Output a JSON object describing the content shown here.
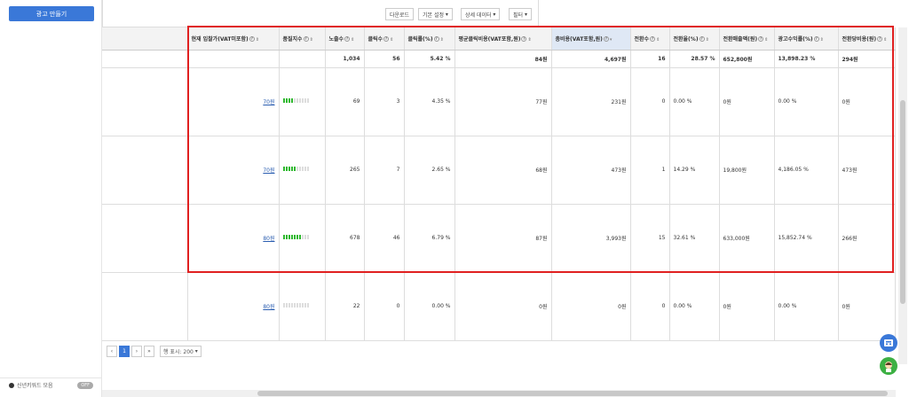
{
  "sidebar": {
    "create_ad_label": "광고 만들기",
    "footer_label": "신년키워드 모음",
    "footer_badge": "OFF"
  },
  "toolbar": {
    "download": "다운로드",
    "basic_settings": "기본 설정",
    "detail_data": "상세 데이터",
    "filter": "필터"
  },
  "table": {
    "headers": [
      "현재 입찰가(VAT미포함)",
      "품질지수",
      "노출수",
      "클릭수",
      "클릭률(%)",
      "평균클릭비용(VAT포함,원)",
      "총비용(VAT포함,원)",
      "전환수",
      "전환율(%)",
      "전환매출액(원)",
      "광고수익률(%)",
      "전환당비용(원)"
    ],
    "totals": [
      "",
      "",
      "1,034",
      "56",
      "5.42 %",
      "84원",
      "4,697원",
      "16",
      "28.57 %",
      "652,800원",
      "13,898.23 %",
      "294원"
    ],
    "rows": [
      {
        "bid": "70원",
        "quality": 4,
        "cells": [
          "69",
          "3",
          "4.35 %",
          "77원",
          "231원",
          "0",
          "0.00 %",
          "0원",
          "0.00 %",
          "0원"
        ]
      },
      {
        "bid": "70원",
        "quality": 5,
        "cells": [
          "265",
          "7",
          "2.65 %",
          "68원",
          "473원",
          "1",
          "14.29 %",
          "19,800원",
          "4,186.05 %",
          "473원"
        ]
      },
      {
        "bid": "80원",
        "quality": 7,
        "cells": [
          "678",
          "46",
          "6.79 %",
          "87원",
          "3,993원",
          "15",
          "32.61 %",
          "633,000원",
          "15,852.74 %",
          "266원"
        ]
      },
      {
        "bid": "80원",
        "quality": 0,
        "cells": [
          "22",
          "0",
          "0.00 %",
          "0원",
          "0원",
          "0",
          "0.00 %",
          "0원",
          "0.00 %",
          "0원"
        ]
      }
    ]
  },
  "pager": {
    "prev": "‹",
    "page": "1",
    "next": "›",
    "last": "»",
    "first": "«",
    "rows_label": "행 표시: 200"
  },
  "colors": {
    "accent": "#3a78d8",
    "highlight": "#e02020",
    "quality_on": "#2eb82e"
  }
}
